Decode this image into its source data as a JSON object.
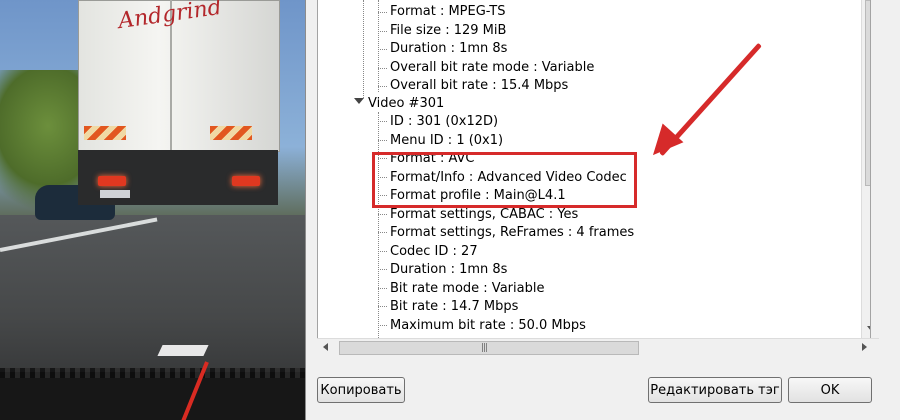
{
  "tree": {
    "general": [
      {
        "id": "format",
        "text": "Format : MPEG-TS"
      },
      {
        "id": "file-size",
        "text": "File size : 129 MiB"
      },
      {
        "id": "duration",
        "text": "Duration : 1mn 8s"
      },
      {
        "id": "overall-bit-rate-mode",
        "text": "Overall bit rate mode : Variable"
      },
      {
        "id": "overall-bit-rate",
        "text": "Overall bit rate : 15.4 Mbps"
      }
    ],
    "video_header": "Video #301",
    "video": [
      {
        "id": "video-id",
        "text": "ID : 301 (0x12D)"
      },
      {
        "id": "menu-id",
        "text": "Menu ID : 1 (0x1)"
      },
      {
        "id": "video-format",
        "text": "Format : AVC"
      },
      {
        "id": "format-info",
        "text": "Format/Info : Advanced Video Codec"
      },
      {
        "id": "format-profile",
        "text": "Format profile : Main@L4.1"
      },
      {
        "id": "format-settings-cabac",
        "text": "Format settings, CABAC : Yes"
      },
      {
        "id": "format-settings-reframes",
        "text": "Format settings, ReFrames : 4 frames"
      },
      {
        "id": "codec-id",
        "text": "Codec ID : 27"
      },
      {
        "id": "video-duration",
        "text": "Duration : 1mn 8s"
      },
      {
        "id": "bit-rate-mode",
        "text": "Bit rate mode : Variable"
      },
      {
        "id": "bit-rate",
        "text": "Bit rate : 14.7 Mbps"
      },
      {
        "id": "maximum-bit-rate",
        "text": "Maximum bit rate : 50.0 Mbps"
      }
    ]
  },
  "background": {
    "truck_logo": "Andgrind"
  },
  "buttons": {
    "copy": "Копировать",
    "edit_tag": "Редактировать тэг",
    "ok": "OK"
  },
  "colors": {
    "annotation": "#d62a2a",
    "window_bg": "#f0f0f0"
  }
}
